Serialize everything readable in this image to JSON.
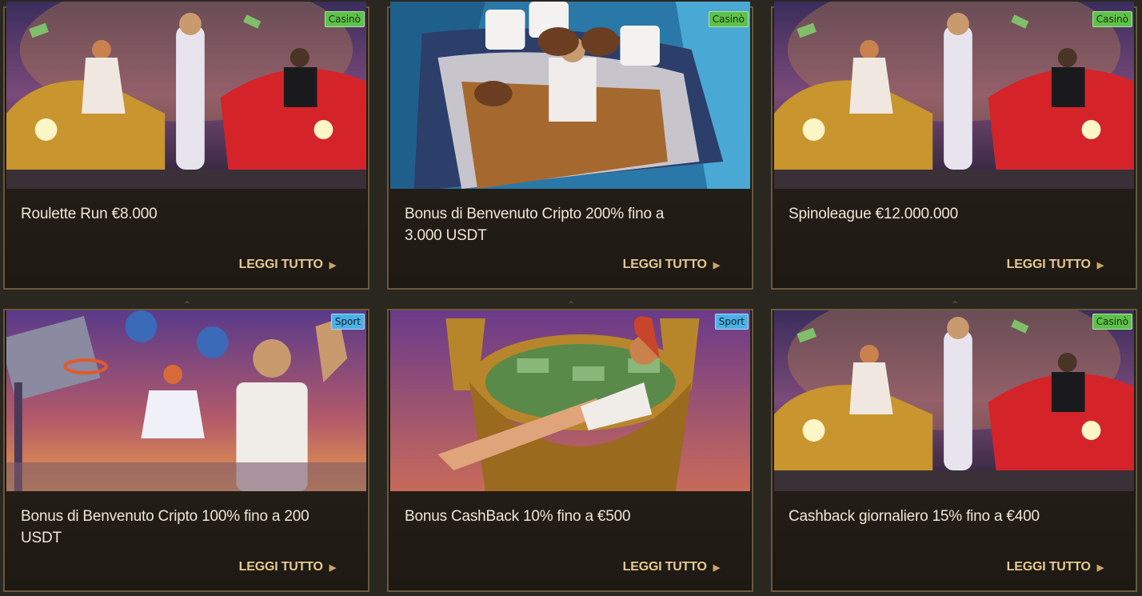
{
  "promotions": [
    {
      "title": "Roulette Run €8.000",
      "badge": "Casinò",
      "cta": "LEGGI TUTTO",
      "scene": "cars"
    },
    {
      "title": "Bonus di Benvenuto Cripto 200% fino a 3.000 USDT",
      "badge": "Casinò",
      "cta": "LEGGI TUTTO",
      "scene": "boat"
    },
    {
      "title": "Spinoleague €12.000.000",
      "badge": "Casinò",
      "cta": "LEGGI TUTTO",
      "scene": "cars"
    },
    {
      "title": "Bonus di Benvenuto Cripto 100% fino a 200 USDT",
      "badge": "Sport",
      "cta": "LEGGI TUTTO",
      "scene": "basket"
    },
    {
      "title": "Bonus CashBack 10% fino a €500",
      "badge": "Sport",
      "cta": "LEGGI TUTTO",
      "scene": "money"
    },
    {
      "title": "Cashback giornaliero 15% fino a €400",
      "badge": "Casinò",
      "cta": "LEGGI TUTTO",
      "scene": "cars"
    }
  ],
  "colors": {
    "casino_badge": "#5ec24a",
    "sport_badge": "#4ab2e6",
    "cta": "#e5c98f",
    "border": "#6a5a3a"
  },
  "icons": {
    "cta_arrow": "triangle-right-icon"
  }
}
